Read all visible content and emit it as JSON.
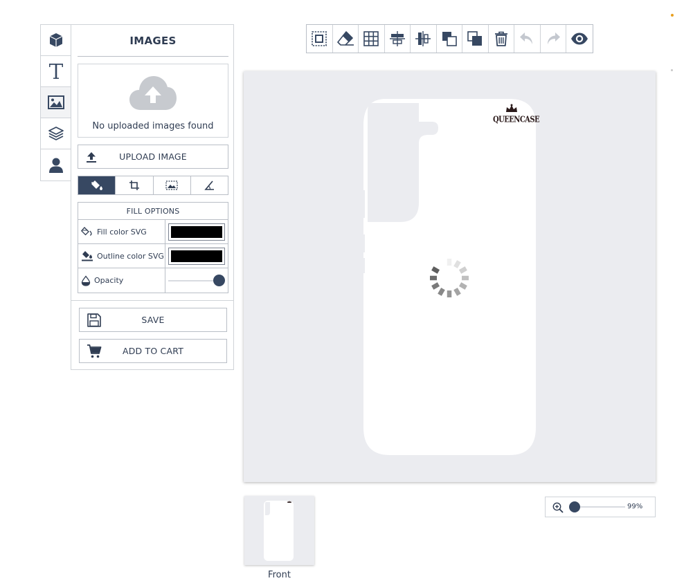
{
  "sidebar": {
    "tabs": [
      {
        "icon": "cube-icon"
      },
      {
        "icon": "text-icon"
      },
      {
        "icon": "image-icon"
      },
      {
        "icon": "layers-icon"
      },
      {
        "icon": "user-icon"
      }
    ]
  },
  "panel": {
    "title": "IMAGES",
    "upload_box_message": "No uploaded images found",
    "upload_button": "UPLOAD IMAGE",
    "mini_tabs": [
      {
        "icon": "paint-bucket-icon",
        "active": true
      },
      {
        "icon": "crop-icon"
      },
      {
        "icon": "image-mask-icon"
      },
      {
        "icon": "angle-icon"
      }
    ],
    "fill_options": {
      "header": "FILL OPTIONS",
      "fill_color_label": "Fill color SVG",
      "fill_color": "#000000",
      "outline_color_label": "Outline color SVG",
      "outline_color": "#000000",
      "opacity_label": "Opacity",
      "opacity_value": 1.0
    },
    "save_button": "SAVE",
    "add_to_cart_button": "ADD TO CART"
  },
  "toolbar": {
    "buttons": [
      {
        "icon": "select-frame-icon"
      },
      {
        "icon": "eraser-icon"
      },
      {
        "icon": "grid-icon"
      },
      {
        "icon": "align-horizontal-center-icon"
      },
      {
        "icon": "align-vertical-center-icon"
      },
      {
        "icon": "bring-forward-icon"
      },
      {
        "icon": "send-backward-icon"
      },
      {
        "icon": "trash-icon"
      },
      {
        "icon": "undo-icon",
        "disabled": true
      },
      {
        "icon": "redo-icon",
        "disabled": true
      },
      {
        "icon": "eye-icon"
      }
    ]
  },
  "canvas": {
    "brand_text": "QUEENCASE",
    "loading": true
  },
  "views": [
    {
      "label": "Front",
      "active": true
    }
  ],
  "zoom": {
    "value_label": "99%",
    "value": 0.99
  },
  "colors": {
    "accent": "#374862",
    "canvas_bg": "#ebecf0",
    "border": "#cfd3d8",
    "text": "#2f3c52"
  }
}
